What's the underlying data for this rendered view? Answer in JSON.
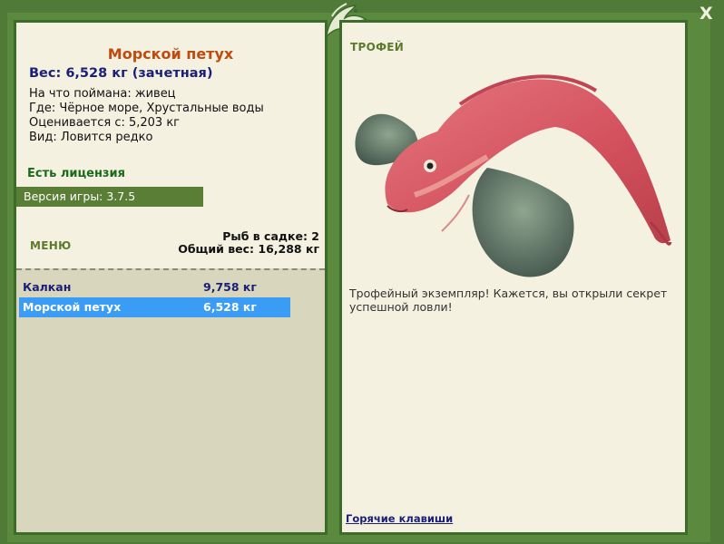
{
  "window": {
    "close_label": "X"
  },
  "fish": {
    "name": "Морской петух",
    "weight": "Вес: 6,528 кг (зачетная)",
    "caught_on": "На что поймана: живец",
    "location": "Где: Чёрное море, Хрустальные воды",
    "valued_from": "Оценивается с: 5,203 кг",
    "kind": "Вид: Ловится редко"
  },
  "license": "Есть лицензия",
  "version": "Версия игры: 3.7.5",
  "menu_label": "МЕНЮ",
  "keep": {
    "count": "Рыб в садке: 2",
    "total": "Общий вес: 16,288 кг"
  },
  "catch_list": [
    {
      "name": "Калкан",
      "weight": "9,758 кг"
    },
    {
      "name": "Морской петух",
      "weight": "6,528 кг"
    }
  ],
  "trophy_label": "ТРОФЕЙ",
  "trophy_text": "Трофейный экземпляр! Кажется, вы открыли секрет успешной ловли!",
  "hotkeys_link": "Горячие клавиши",
  "colors": {
    "frame": "#4f7a38",
    "panel": "#f4f1e0",
    "accent": "#c04b10",
    "selection": "#3b9cf6"
  },
  "icons": {
    "logo": "fish-logo-icon",
    "close": "close-icon"
  }
}
